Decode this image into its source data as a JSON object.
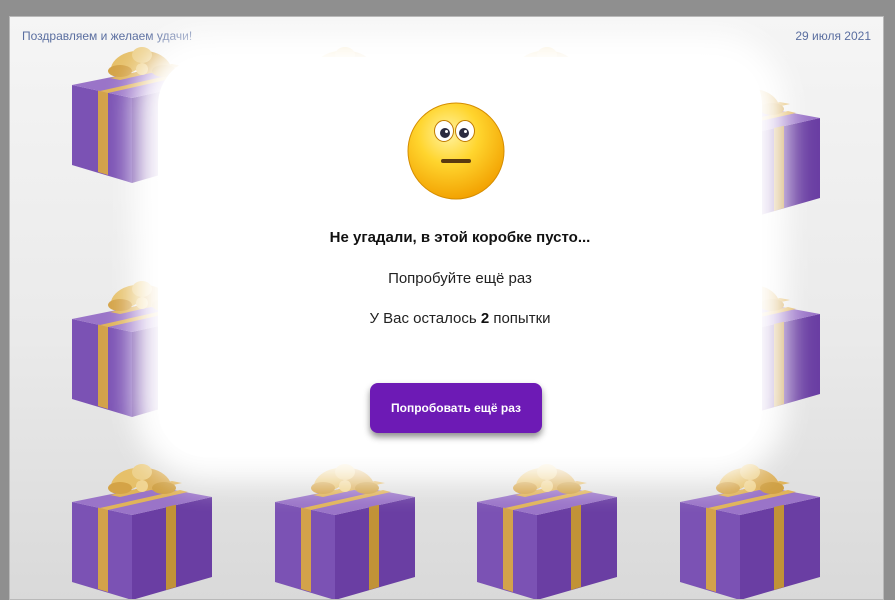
{
  "header": {
    "left_text": "Поздравляем и желаем удачи!",
    "date": "29 июля 2021"
  },
  "modal": {
    "icon": "neutral-face-icon",
    "title": "Не угадали, в этой коробке пусто...",
    "subtitle": "Попробуйте ещё раз",
    "tries_prefix": "У Вас осталось",
    "tries_count": "2",
    "tries_suffix": "попытки",
    "button_label": "Попробовать ещё раз"
  },
  "colors": {
    "button": "#6d1ab5",
    "gift_box": "#7a4cb0",
    "ribbon": "#d9ab46",
    "header_text": "#5a6ea0"
  }
}
